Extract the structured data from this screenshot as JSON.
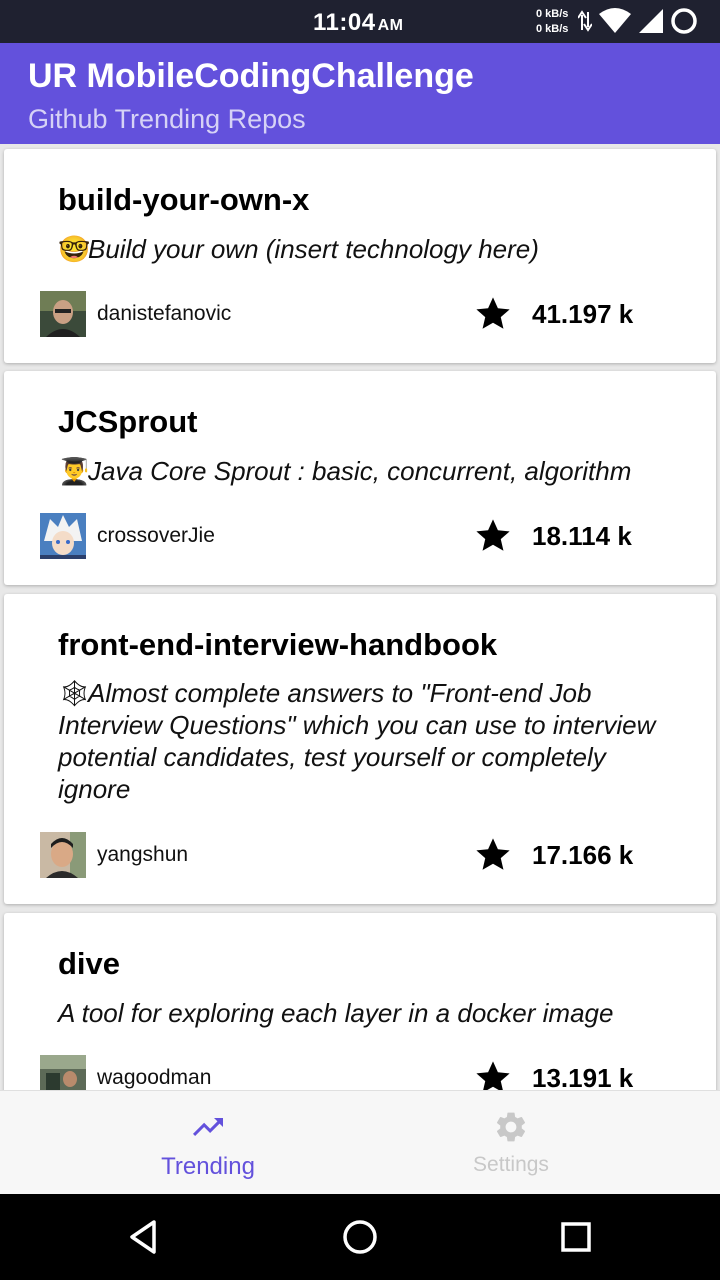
{
  "status_bar": {
    "time": "11:04",
    "ampm": "AM",
    "net_up": "0 kB/s",
    "net_down": "0 kB/s"
  },
  "app_bar": {
    "title": "UR MobileCodingChallenge",
    "subtitle": "Github Trending Repos",
    "color": "#6351dc"
  },
  "repos": [
    {
      "name": "build-your-own-x",
      "emoji": "🤓",
      "description": "Build your own (insert technology here)",
      "owner": "danistefanovic",
      "stars": "41.197 k"
    },
    {
      "name": "JCSprout",
      "emoji": "👨‍🎓",
      "description": "Java Core Sprout : basic, concurrent, algorithm",
      "owner": "crossoverJie",
      "stars": "18.114 k"
    },
    {
      "name": "front-end-interview-handbook",
      "emoji": "🕸",
      "description": "Almost complete answers to \"Front-end Job Interview Questions\" which you can use to interview potential candidates, test yourself or completely ignore",
      "owner": "yangshun",
      "stars": "17.166 k"
    },
    {
      "name": "dive",
      "emoji": "",
      "description": "A tool for exploring each layer in a docker image",
      "owner": "wagoodman",
      "stars": "13.191 k"
    }
  ],
  "bottom_nav": {
    "trending_label": "Trending",
    "settings_label": "Settings",
    "active_tab": "Trending",
    "active_color": "#6351dc",
    "inactive_color": "#c8c8c8"
  },
  "icons": {
    "trending": "trending-up-icon",
    "settings": "gear-icon",
    "star": "star-icon",
    "back": "back-icon",
    "home": "home-icon",
    "recents": "recents-icon"
  }
}
